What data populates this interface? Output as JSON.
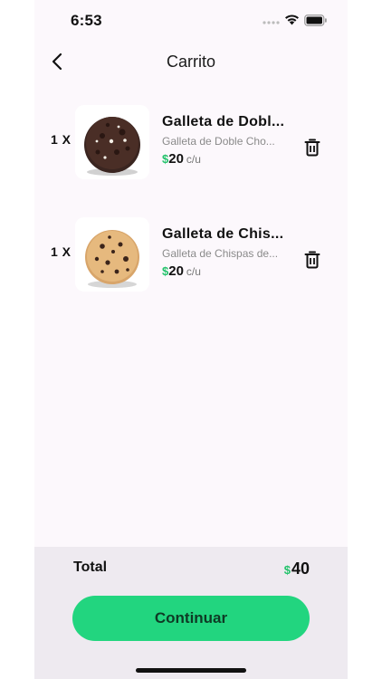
{
  "status_bar": {
    "time": "6:53"
  },
  "header": {
    "title": "Carrito"
  },
  "cart": {
    "items": [
      {
        "qty": "1 X",
        "name": "Galleta de Dobl...",
        "description": "Galleta de Doble Cho...",
        "currency": "$",
        "price": "20",
        "unit": "c/u"
      },
      {
        "qty": "1 X",
        "name": "Galleta de Chis...",
        "description": "Galleta de Chispas de...",
        "currency": "$",
        "price": "20",
        "unit": "c/u"
      }
    ]
  },
  "footer": {
    "total_label": "Total",
    "total_currency": "$",
    "total_value": "40",
    "continue_label": "Continuar"
  },
  "colors": {
    "accent": "#22d57f",
    "price_currency": "#23c26b",
    "background": "#fcf8fc",
    "footer_bg": "#eeeaf0"
  },
  "icons": [
    "back-chevron-icon",
    "trash-icon",
    "wifi-icon",
    "battery-icon",
    "signal-icon"
  ]
}
